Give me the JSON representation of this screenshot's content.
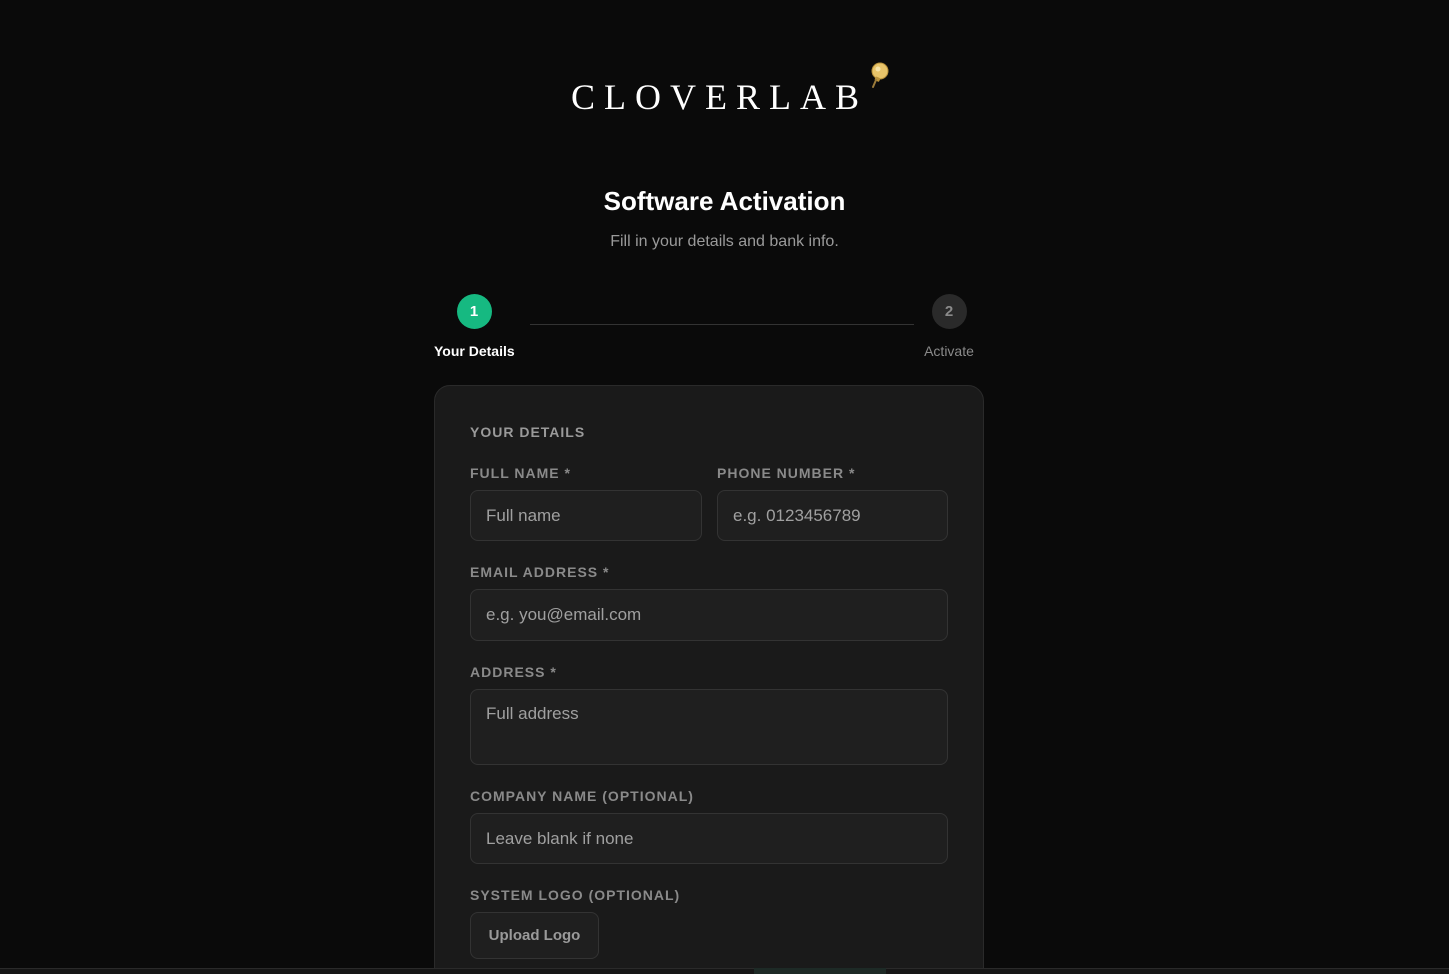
{
  "brand": {
    "name": "CLOVERLAB",
    "accent_color": "#16b981",
    "bulb_color": "#e8c46a"
  },
  "header": {
    "title": "Software Activation",
    "subtitle": "Fill in your details and bank info."
  },
  "stepper": {
    "steps": [
      {
        "number": "1",
        "label": "Your Details",
        "state": "active"
      },
      {
        "number": "2",
        "label": "Activate",
        "state": "inactive"
      }
    ]
  },
  "form": {
    "section_title": "YOUR DETAILS",
    "full_name": {
      "label": "FULL NAME *",
      "placeholder": "Full name",
      "value": ""
    },
    "phone": {
      "label": "PHONE NUMBER *",
      "placeholder": "e.g. 0123456789",
      "value": ""
    },
    "email": {
      "label": "EMAIL ADDRESS *",
      "placeholder": "e.g. you@email.com",
      "value": ""
    },
    "address": {
      "label": "ADDRESS *",
      "placeholder": "Full address",
      "value": ""
    },
    "company": {
      "label": "COMPANY NAME (OPTIONAL)",
      "placeholder": "Leave blank if none",
      "value": ""
    },
    "logo": {
      "label": "SYSTEM LOGO (OPTIONAL)",
      "button_label": "Upload Logo"
    }
  }
}
